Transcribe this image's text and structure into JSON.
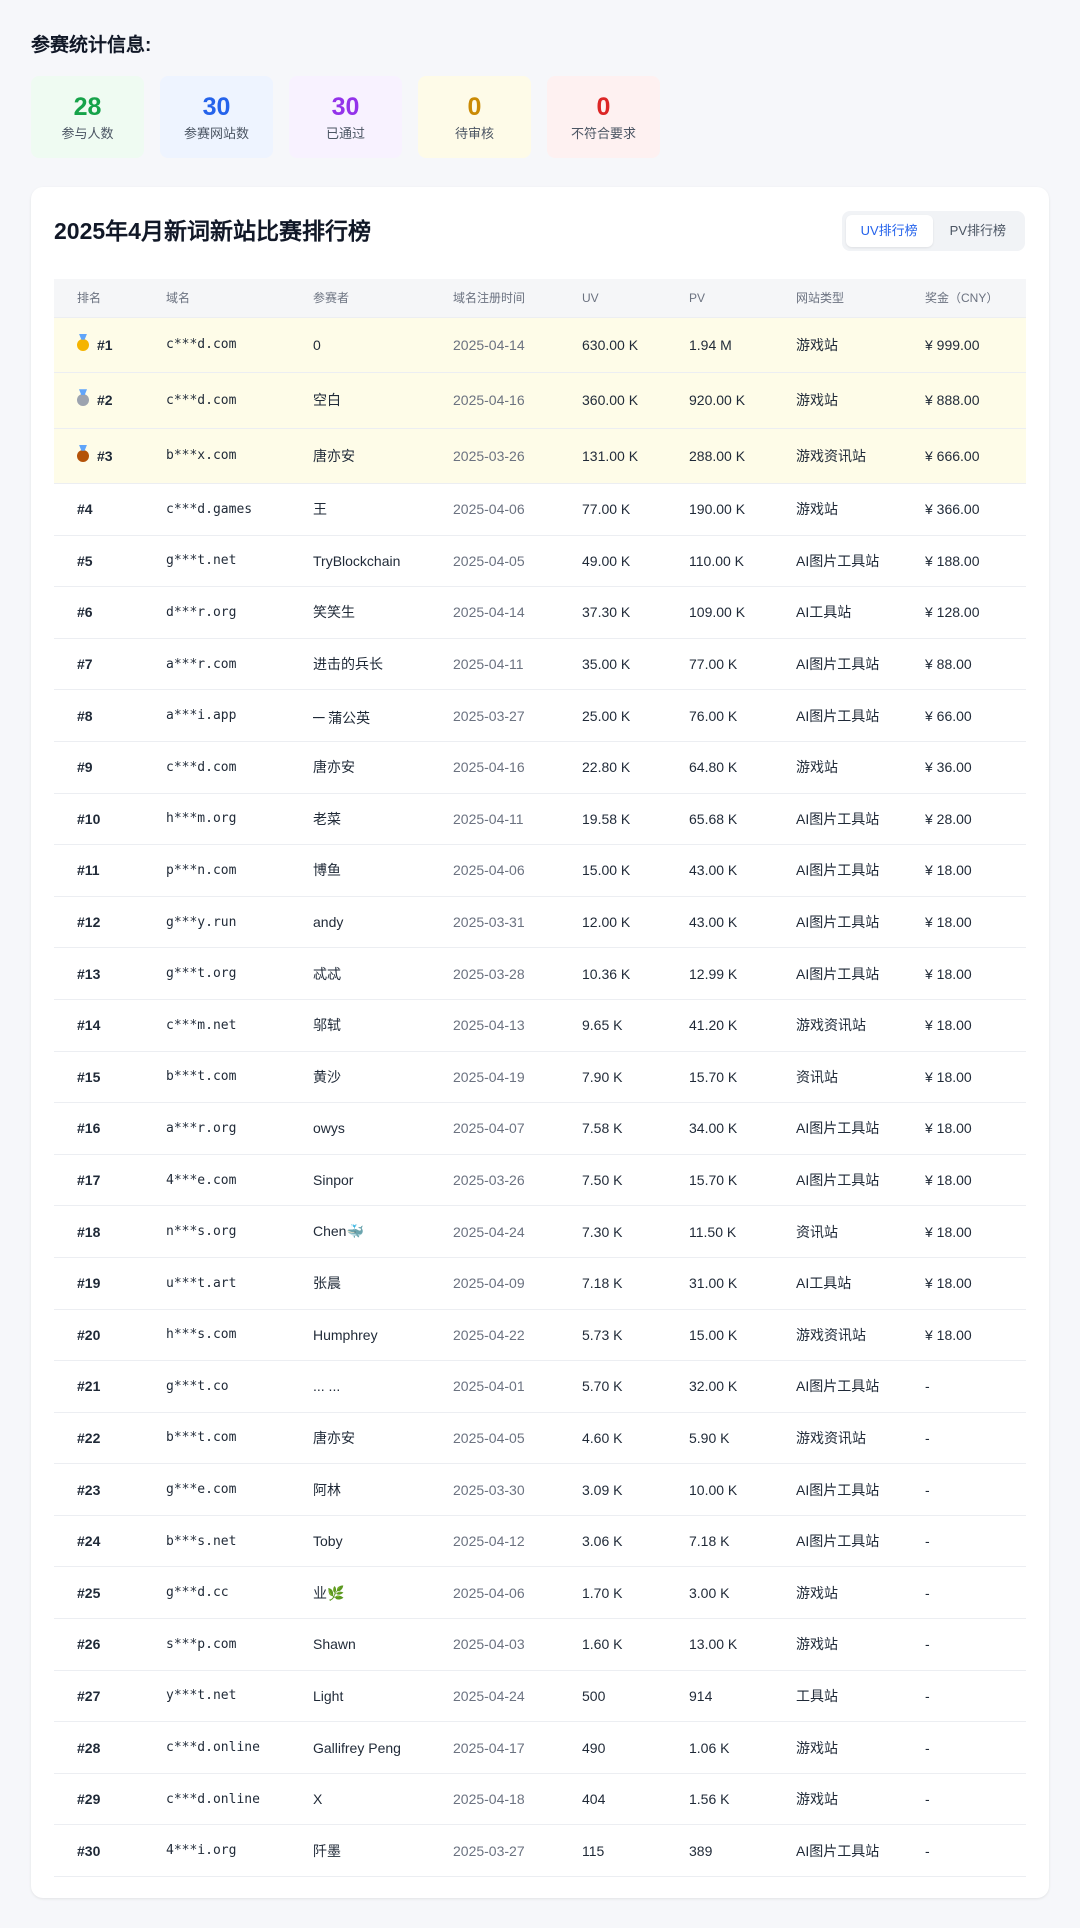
{
  "stats": {
    "heading": "参赛统计信息:",
    "cards": [
      {
        "value": "28",
        "label": "参与人数",
        "color": "#16a34a",
        "bg": "#effbf2"
      },
      {
        "value": "30",
        "label": "参赛网站数",
        "color": "#2563eb",
        "bg": "#eef4ff"
      },
      {
        "value": "30",
        "label": "已通过",
        "color": "#9333ea",
        "bg": "#f8f2ff"
      },
      {
        "value": "0",
        "label": "待审核",
        "color": "#ca8a04",
        "bg": "#fefbe8"
      },
      {
        "value": "0",
        "label": "不符合要求",
        "color": "#dc2626",
        "bg": "#fef1f1"
      }
    ]
  },
  "leaderboard": {
    "title": "2025年4月新词新站比赛排行榜",
    "tabs": [
      {
        "label": "UV排行榜",
        "active": true
      },
      {
        "label": "PV排行榜",
        "active": false
      }
    ],
    "columns": [
      "排名",
      "域名",
      "参赛者",
      "域名注册时间",
      "UV",
      "PV",
      "网站类型",
      "奖金（CNY）"
    ],
    "rows": [
      {
        "rank": "#1",
        "domain": "c***d.com",
        "participant": "0",
        "date": "2025-04-14",
        "uv": "630.00 K",
        "pv": "1.94 M",
        "type": "游戏站",
        "prize": "¥ 999.00",
        "medal": "gold"
      },
      {
        "rank": "#2",
        "domain": "c***d.com",
        "participant": "空白",
        "date": "2025-04-16",
        "uv": "360.00 K",
        "pv": "920.00 K",
        "type": "游戏站",
        "prize": "¥ 888.00",
        "medal": "silver"
      },
      {
        "rank": "#3",
        "domain": "b***x.com",
        "participant": "唐亦安",
        "date": "2025-03-26",
        "uv": "131.00 K",
        "pv": "288.00 K",
        "type": "游戏资讯站",
        "prize": "¥ 666.00",
        "medal": "bronze"
      },
      {
        "rank": "#4",
        "domain": "c***d.games",
        "participant": "王",
        "date": "2025-04-06",
        "uv": "77.00 K",
        "pv": "190.00 K",
        "type": "游戏站",
        "prize": "¥ 366.00"
      },
      {
        "rank": "#5",
        "domain": "g***t.net",
        "participant": "TryBlockchain",
        "date": "2025-04-05",
        "uv": "49.00 K",
        "pv": "110.00 K",
        "type": "AI图片工具站",
        "prize": "¥ 188.00"
      },
      {
        "rank": "#6",
        "domain": "d***r.org",
        "participant": "笑笑生",
        "date": "2025-04-14",
        "uv": "37.30 K",
        "pv": "109.00 K",
        "type": "AI工具站",
        "prize": "¥ 128.00"
      },
      {
        "rank": "#7",
        "domain": "a***r.com",
        "participant": "进击的兵长",
        "date": "2025-04-11",
        "uv": "35.00 K",
        "pv": "77.00 K",
        "type": "AI图片工具站",
        "prize": "¥ 88.00"
      },
      {
        "rank": "#8",
        "domain": "a***i.app",
        "participant": "᠆᠆ 蒲公英",
        "date": "2025-03-27",
        "uv": "25.00 K",
        "pv": "76.00 K",
        "type": "AI图片工具站",
        "prize": "¥ 66.00"
      },
      {
        "rank": "#9",
        "domain": "c***d.com",
        "participant": "唐亦安",
        "date": "2025-04-16",
        "uv": "22.80 K",
        "pv": "64.80 K",
        "type": "游戏站",
        "prize": "¥ 36.00"
      },
      {
        "rank": "#10",
        "domain": "h***m.org",
        "participant": "老菜",
        "date": "2025-04-11",
        "uv": "19.58 K",
        "pv": "65.68 K",
        "type": "AI图片工具站",
        "prize": "¥ 28.00"
      },
      {
        "rank": "#11",
        "domain": "p***n.com",
        "participant": "博鱼",
        "date": "2025-04-06",
        "uv": "15.00 K",
        "pv": "43.00 K",
        "type": "AI图片工具站",
        "prize": "¥ 18.00"
      },
      {
        "rank": "#12",
        "domain": "g***y.run",
        "participant": "andy",
        "date": "2025-03-31",
        "uv": "12.00 K",
        "pv": "43.00 K",
        "type": "AI图片工具站",
        "prize": "¥ 18.00"
      },
      {
        "rank": "#13",
        "domain": "g***t.org",
        "participant": "忒忒",
        "date": "2025-03-28",
        "uv": "10.36 K",
        "pv": "12.99 K",
        "type": "AI图片工具站",
        "prize": "¥ 18.00"
      },
      {
        "rank": "#14",
        "domain": "c***m.net",
        "participant": "邬轼",
        "date": "2025-04-13",
        "uv": "9.65 K",
        "pv": "41.20 K",
        "type": "游戏资讯站",
        "prize": "¥ 18.00"
      },
      {
        "rank": "#15",
        "domain": "b***t.com",
        "participant": "黄沙",
        "date": "2025-04-19",
        "uv": "7.90 K",
        "pv": "15.70 K",
        "type": "资讯站",
        "prize": "¥ 18.00"
      },
      {
        "rank": "#16",
        "domain": "a***r.org",
        "participant": "owys",
        "date": "2025-04-07",
        "uv": "7.58 K",
        "pv": "34.00 K",
        "type": "AI图片工具站",
        "prize": "¥ 18.00"
      },
      {
        "rank": "#17",
        "domain": "4***e.com",
        "participant": "Sinpor",
        "date": "2025-03-26",
        "uv": "7.50 K",
        "pv": "15.70 K",
        "type": "AI图片工具站",
        "prize": "¥ 18.00"
      },
      {
        "rank": "#18",
        "domain": "n***s.org",
        "participant": "Chen🐳",
        "date": "2025-04-24",
        "uv": "7.30 K",
        "pv": "11.50 K",
        "type": "资讯站",
        "prize": "¥ 18.00"
      },
      {
        "rank": "#19",
        "domain": "u***t.art",
        "participant": "张晨",
        "date": "2025-04-09",
        "uv": "7.18 K",
        "pv": "31.00 K",
        "type": "AI工具站",
        "prize": "¥ 18.00"
      },
      {
        "rank": "#20",
        "domain": "h***s.com",
        "participant": "Humphrey",
        "date": "2025-04-22",
        "uv": "5.73 K",
        "pv": "15.00 K",
        "type": "游戏资讯站",
        "prize": "¥ 18.00"
      },
      {
        "rank": "#21",
        "domain": "g***t.co",
        "participant": "... ...",
        "date": "2025-04-01",
        "uv": "5.70 K",
        "pv": "32.00 K",
        "type": "AI图片工具站",
        "prize": "-"
      },
      {
        "rank": "#22",
        "domain": "b***t.com",
        "participant": "唐亦安",
        "date": "2025-04-05",
        "uv": "4.60 K",
        "pv": "5.90 K",
        "type": "游戏资讯站",
        "prize": "-"
      },
      {
        "rank": "#23",
        "domain": "g***e.com",
        "participant": "阿林",
        "date": "2025-03-30",
        "uv": "3.09 K",
        "pv": "10.00 K",
        "type": "AI图片工具站",
        "prize": "-"
      },
      {
        "rank": "#24",
        "domain": "b***s.net",
        "participant": "Toby",
        "date": "2025-04-12",
        "uv": "3.06 K",
        "pv": "7.18 K",
        "type": "AI图片工具站",
        "prize": "-"
      },
      {
        "rank": "#25",
        "domain": "g***d.cc",
        "participant": "业🌿",
        "date": "2025-04-06",
        "uv": "1.70 K",
        "pv": "3.00 K",
        "type": "游戏站",
        "prize": "-"
      },
      {
        "rank": "#26",
        "domain": "s***p.com",
        "participant": "Shawn",
        "date": "2025-04-03",
        "uv": "1.60 K",
        "pv": "13.00 K",
        "type": "游戏站",
        "prize": "-"
      },
      {
        "rank": "#27",
        "domain": "y***t.net",
        "participant": "Light",
        "date": "2025-04-24",
        "uv": "500",
        "pv": "914",
        "type": "工具站",
        "prize": "-"
      },
      {
        "rank": "#28",
        "domain": "c***d.online",
        "participant": "Gallifrey Peng",
        "date": "2025-04-17",
        "uv": "490",
        "pv": "1.06 K",
        "type": "游戏站",
        "prize": "-"
      },
      {
        "rank": "#29",
        "domain": "c***d.online",
        "participant": "X",
        "date": "2025-04-18",
        "uv": "404",
        "pv": "1.56 K",
        "type": "游戏站",
        "prize": "-"
      },
      {
        "rank": "#30",
        "domain": "4***i.org",
        "participant": "阡墨",
        "date": "2025-03-27",
        "uv": "115",
        "pv": "389",
        "type": "AI图片工具站",
        "prize": "-"
      }
    ]
  }
}
